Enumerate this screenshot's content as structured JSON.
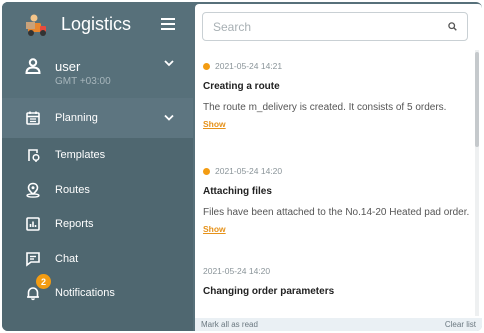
{
  "sidebar": {
    "brand": "Logistics",
    "user": {
      "name": "user",
      "timezone": "GMT +03:00"
    },
    "items": [
      {
        "label": "Planning",
        "icon": "calendar-icon"
      },
      {
        "label": "Templates",
        "icon": "template-icon"
      },
      {
        "label": "Routes",
        "icon": "route-icon"
      },
      {
        "label": "Reports",
        "icon": "report-icon"
      },
      {
        "label": "Chat",
        "icon": "chat-icon"
      },
      {
        "label": "Notifications",
        "icon": "bell-icon",
        "badge": "2"
      }
    ]
  },
  "panel": {
    "search_placeholder": "Search",
    "notifications": [
      {
        "time": "2021-05-24 14:21",
        "title": "Creating a route",
        "text": "The route m_delivery is created. It consists of 5 orders.",
        "link": "Show",
        "unread": true
      },
      {
        "time": "2021-05-24 14:20",
        "title": "Attaching files",
        "text": "Files have been attached to the No.14-20 Heated pad order.",
        "link": "Show",
        "unread": true
      },
      {
        "time": "2021-05-24 14:20",
        "title": "Changing order parameters",
        "unread": false
      }
    ],
    "footer": {
      "mark_all": "Mark all as read",
      "clear": "Clear list"
    }
  },
  "colors": {
    "sidebar": "#4f6770",
    "accent": "#f39c12",
    "link": "#e6921a"
  }
}
